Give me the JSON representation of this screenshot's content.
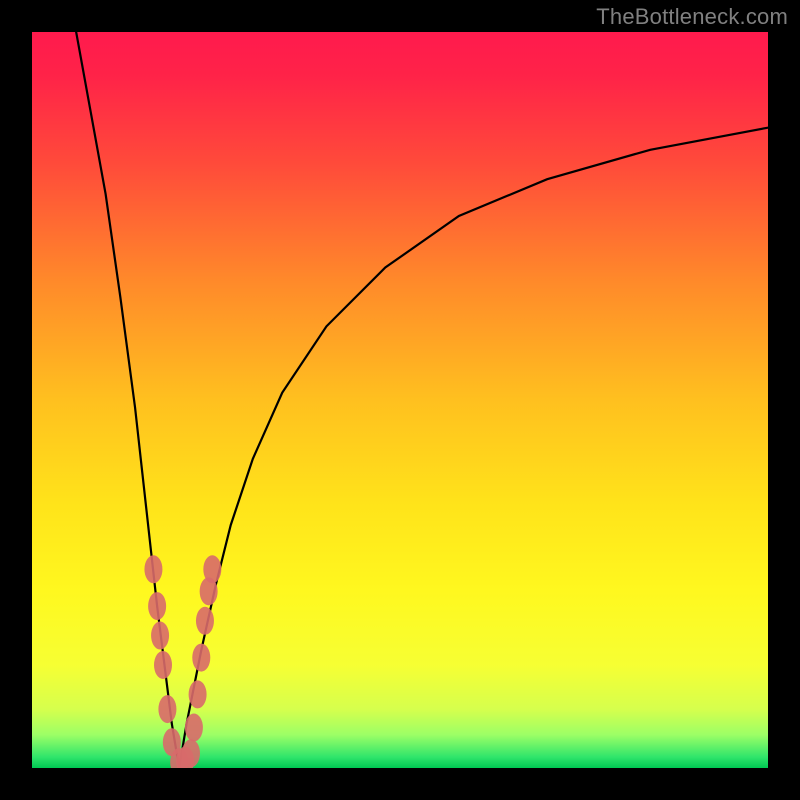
{
  "watermark": "TheBottleneck.com",
  "gradient": {
    "stops": [
      {
        "offset": 0.0,
        "color": "#ff1a4d"
      },
      {
        "offset": 0.06,
        "color": "#ff2348"
      },
      {
        "offset": 0.18,
        "color": "#ff4b3a"
      },
      {
        "offset": 0.34,
        "color": "#ff8a2a"
      },
      {
        "offset": 0.5,
        "color": "#ffc01f"
      },
      {
        "offset": 0.64,
        "color": "#ffe31a"
      },
      {
        "offset": 0.76,
        "color": "#fff81f"
      },
      {
        "offset": 0.86,
        "color": "#f6ff33"
      },
      {
        "offset": 0.92,
        "color": "#d6ff4d"
      },
      {
        "offset": 0.955,
        "color": "#9cff66"
      },
      {
        "offset": 0.985,
        "color": "#30e56b"
      },
      {
        "offset": 1.0,
        "color": "#00c853"
      }
    ]
  },
  "chart_data": {
    "type": "line",
    "title": "",
    "xlabel": "",
    "ylabel": "",
    "xlim": [
      0,
      100
    ],
    "ylim": [
      0,
      100
    ],
    "x_minimum": 20,
    "series": [
      {
        "name": "left-branch",
        "x": [
          6,
          8,
          10,
          12,
          14,
          15,
          16,
          17,
          18,
          19,
          20
        ],
        "y": [
          100,
          89,
          78,
          64,
          49,
          40,
          31,
          22,
          14,
          6,
          0
        ]
      },
      {
        "name": "right-branch",
        "x": [
          20,
          21,
          23,
          25,
          27,
          30,
          34,
          40,
          48,
          58,
          70,
          84,
          100
        ],
        "y": [
          0,
          6,
          16,
          25,
          33,
          42,
          51,
          60,
          68,
          75,
          80,
          84,
          87
        ]
      }
    ],
    "markers": {
      "name": "highlighted-points",
      "color": "#d86a6a",
      "points_xy": [
        [
          16.5,
          27
        ],
        [
          17.0,
          22
        ],
        [
          17.4,
          18
        ],
        [
          17.8,
          14
        ],
        [
          18.4,
          8
        ],
        [
          19.0,
          3.5
        ],
        [
          20.0,
          0.8
        ],
        [
          20.8,
          1.0
        ],
        [
          21.6,
          2.0
        ],
        [
          22.0,
          5.5
        ],
        [
          22.5,
          10
        ],
        [
          23.0,
          15
        ],
        [
          23.5,
          20
        ],
        [
          24.0,
          24
        ],
        [
          24.5,
          27
        ]
      ]
    }
  }
}
